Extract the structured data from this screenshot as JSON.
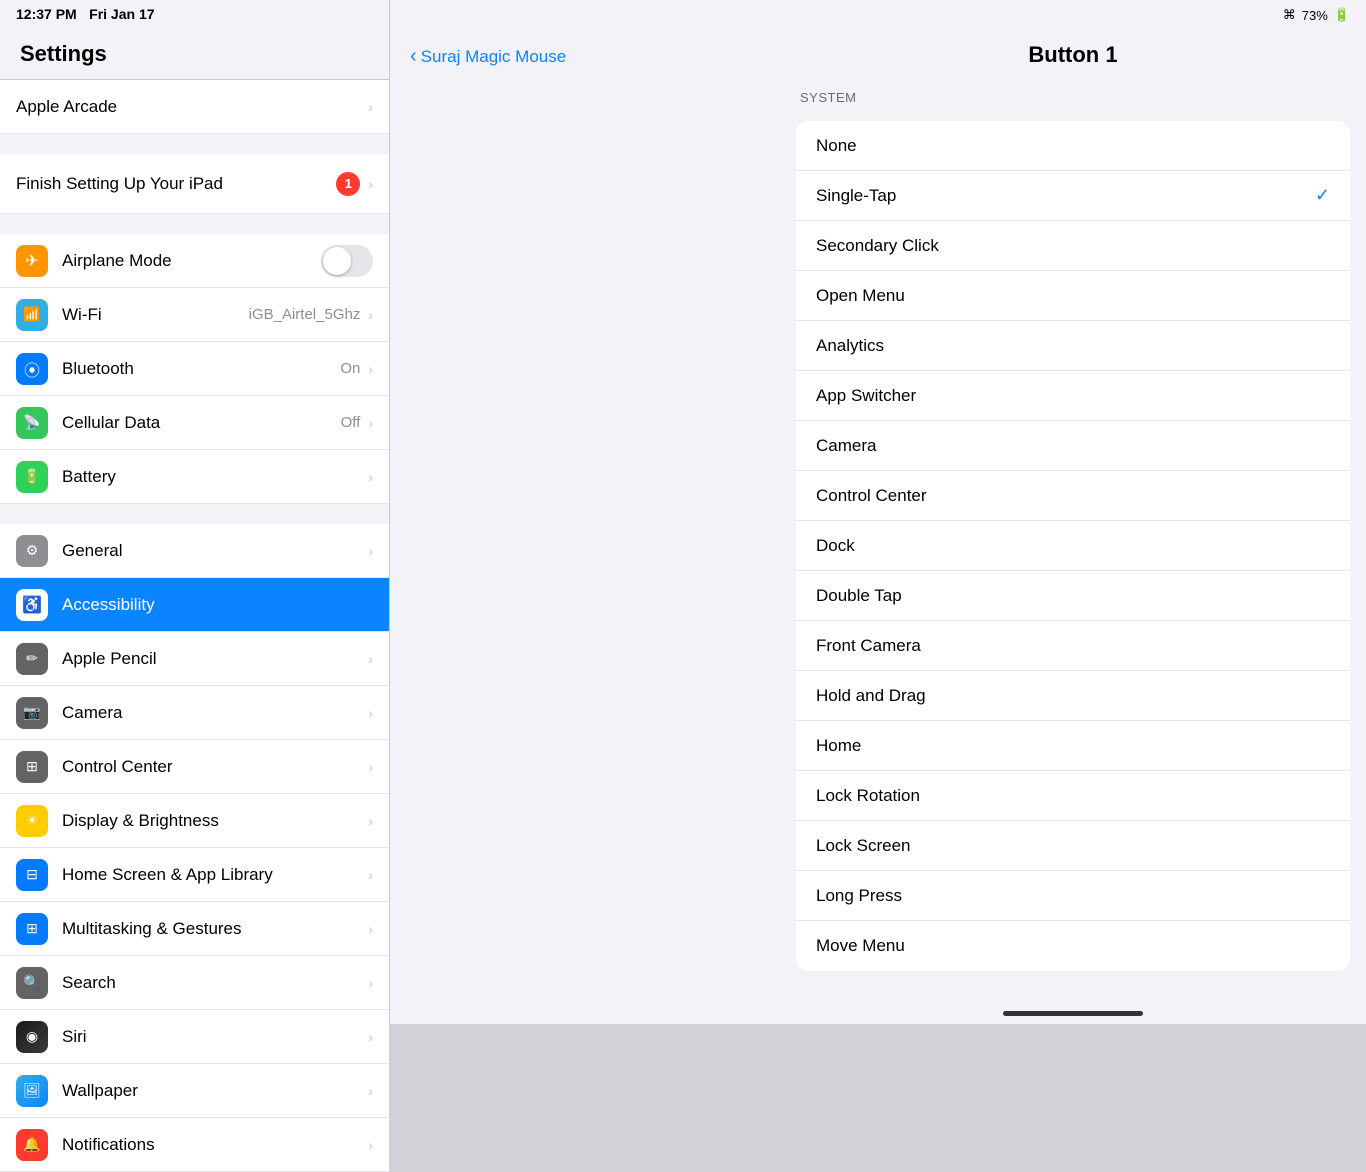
{
  "statusBar": {
    "time": "12:37 PM",
    "date": "Fri Jan 17",
    "wifi": "wifi",
    "battery": "73%"
  },
  "settingsPanel": {
    "title": "Settings",
    "items": [
      {
        "id": "apple-arcade",
        "label": "Apple Arcade",
        "icon": null,
        "value": "",
        "hasToggle": false
      },
      {
        "id": "finish-setup",
        "label": "Finish Setting Up Your iPad",
        "badge": "1"
      },
      {
        "id": "airplane",
        "label": "Airplane Mode",
        "hasToggle": true,
        "iconBg": "icon-orange"
      },
      {
        "id": "wifi",
        "label": "Wi-Fi",
        "value": "iGB_Airtel_5Ghz",
        "iconBg": "icon-blue-light"
      },
      {
        "id": "bluetooth",
        "label": "Bluetooth",
        "value": "On",
        "iconBg": "icon-blue"
      },
      {
        "id": "cellular",
        "label": "Cellular Data",
        "value": "Off",
        "iconBg": "icon-green"
      },
      {
        "id": "battery",
        "label": "Battery",
        "value": "",
        "iconBg": "icon-dark-green"
      },
      {
        "id": "general",
        "label": "General",
        "iconBg": "icon-gray",
        "groupStart": true
      },
      {
        "id": "accessibility",
        "label": "Accessibility",
        "iconBg": "icon-blue-access",
        "selected": true
      },
      {
        "id": "apple-pencil",
        "label": "Apple Pencil",
        "iconBg": "icon-pencil"
      },
      {
        "id": "camera",
        "label": "Camera",
        "iconBg": "icon-camera"
      },
      {
        "id": "control-center",
        "label": "Control Center",
        "iconBg": "icon-cc"
      },
      {
        "id": "display",
        "label": "Display & Brightness",
        "iconBg": "icon-brightness"
      },
      {
        "id": "homescreen",
        "label": "Home Screen & App Library",
        "iconBg": "icon-homescreen"
      },
      {
        "id": "multitasking",
        "label": "Multitasking & Gestures",
        "iconBg": "icon-multitask"
      },
      {
        "id": "search",
        "label": "Search",
        "iconBg": "icon-search"
      },
      {
        "id": "siri",
        "label": "Siri",
        "iconBg": "icon-siri"
      },
      {
        "id": "wallpaper",
        "label": "Wallpaper",
        "iconBg": "icon-wallpaper"
      },
      {
        "id": "notifications",
        "label": "Notifications",
        "iconBg": "icon-notifications"
      }
    ]
  },
  "middlePanel": {
    "backLabel": "Suraj Magic Mouse"
  },
  "rightPanel": {
    "title": "Button 1",
    "sectionHeader": "SYSTEM",
    "options": [
      {
        "id": "none",
        "label": "None",
        "selected": false
      },
      {
        "id": "single-tap",
        "label": "Single-Tap",
        "selected": true
      },
      {
        "id": "secondary-click",
        "label": "Secondary Click",
        "selected": false
      },
      {
        "id": "open-menu",
        "label": "Open Menu",
        "selected": false
      },
      {
        "id": "analytics",
        "label": "Analytics",
        "selected": false
      },
      {
        "id": "app-switcher",
        "label": "App Switcher",
        "selected": false
      },
      {
        "id": "camera-opt",
        "label": "Camera",
        "selected": false
      },
      {
        "id": "control-center-opt",
        "label": "Control Center",
        "selected": false
      },
      {
        "id": "dock",
        "label": "Dock",
        "selected": false
      },
      {
        "id": "double-tap",
        "label": "Double Tap",
        "selected": false
      },
      {
        "id": "front-camera",
        "label": "Front Camera",
        "selected": false
      },
      {
        "id": "hold-and-drag",
        "label": "Hold and Drag",
        "selected": false
      },
      {
        "id": "home",
        "label": "Home",
        "selected": false
      },
      {
        "id": "lock-rotation",
        "label": "Lock Rotation",
        "selected": false
      },
      {
        "id": "lock-screen",
        "label": "Lock Screen",
        "selected": false
      },
      {
        "id": "long-press",
        "label": "Long Press",
        "selected": false
      },
      {
        "id": "move-menu",
        "label": "Move Menu",
        "selected": false
      }
    ]
  }
}
